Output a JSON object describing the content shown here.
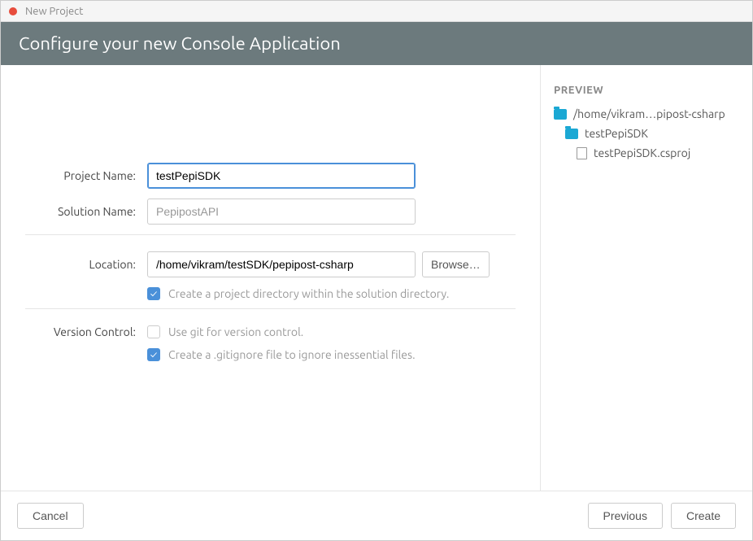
{
  "window": {
    "title": "New Project"
  },
  "header": {
    "title": "Configure your new Console Application"
  },
  "form": {
    "projectName": {
      "label": "Project Name:",
      "value": "testPepiSDK"
    },
    "solutionName": {
      "label": "Solution Name:",
      "value": "PepipostAPI"
    },
    "location": {
      "label": "Location:",
      "value": "/home/vikram/testSDK/pepipost-csharp",
      "browse": "Browse…"
    },
    "createDirectory": {
      "label": "Create a project directory within the solution directory."
    },
    "versionControl": {
      "label": "Version Control:",
      "useGit": "Use git for version control.",
      "gitignore": "Create a .gitignore file to ignore inessential files."
    }
  },
  "preview": {
    "title": "PREVIEW",
    "tree": {
      "root": "/home/vikram…pipost-csharp",
      "project": "testPepiSDK",
      "file": "testPepiSDK.csproj"
    }
  },
  "footer": {
    "cancel": "Cancel",
    "previous": "Previous",
    "create": "Create"
  }
}
